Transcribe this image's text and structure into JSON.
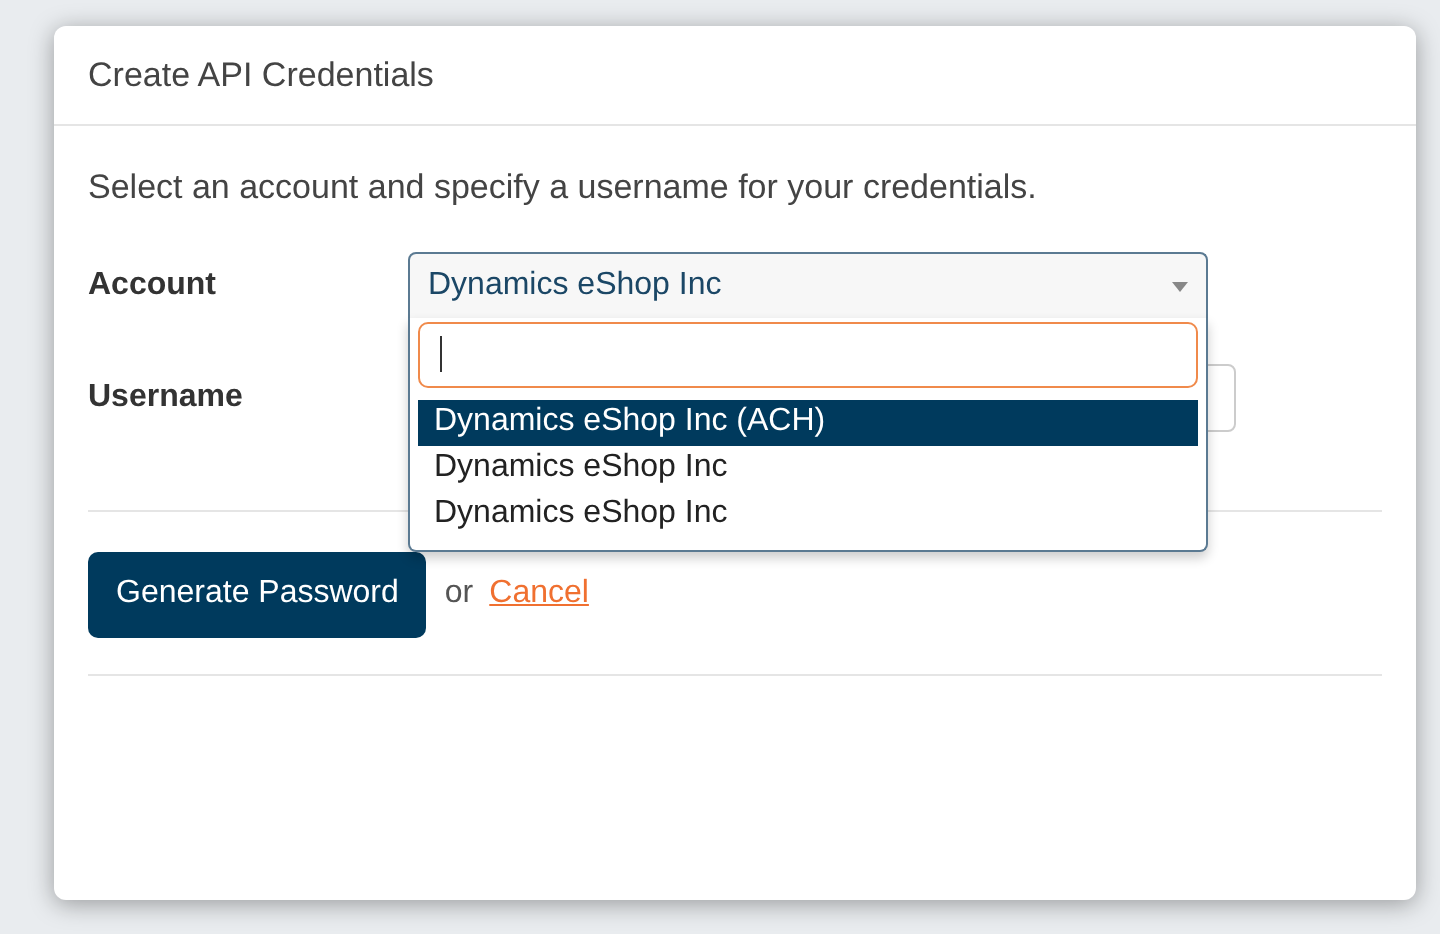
{
  "dialog": {
    "title": "Create API Credentials",
    "description": "Select an account and specify a username for your credentials."
  },
  "account": {
    "label": "Account",
    "value": "Dynamics eShop Inc",
    "expanded": true,
    "options": [
      {
        "label": "Dynamics eShop Inc (ACH)",
        "highlighted": true
      },
      {
        "label": "Dynamics eShop Inc",
        "highlighted": false
      },
      {
        "label": "Dynamics eShop Inc",
        "highlighted": false
      }
    ]
  },
  "username": {
    "label": "Username"
  },
  "actions": {
    "primary": "Generate Password",
    "separator": "or",
    "cancel": "Cancel"
  }
}
